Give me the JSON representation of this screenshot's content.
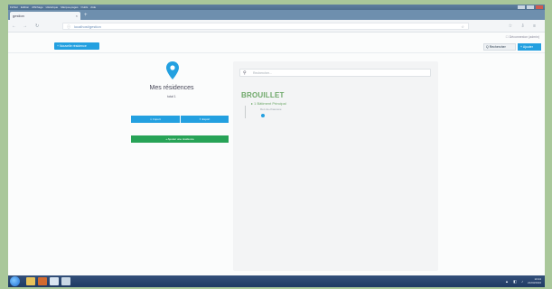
{
  "window": {
    "menu": [
      "Fichier",
      "Edition",
      "Affichage",
      "Historique",
      "Marque-pages",
      "Outils",
      "Aide"
    ],
    "tab_title": "gestion",
    "tab_close": "×",
    "new_tab": "+"
  },
  "addressbar": {
    "url": "localhost/gestion",
    "back": "←",
    "forward": "→",
    "reload": "↻",
    "lock": "ⓘ",
    "star": "☆",
    "right_icons": "☆ ⇩ ≡"
  },
  "apptoolbar": {
    "logout": "☐ Déconnexion (admin)",
    "add_button": "+ Nouvelle résidence",
    "search_button": "Q Rechercher",
    "right_button": "+ Ajouter"
  },
  "left": {
    "title": "Mes résidences",
    "subtitle": "total 1",
    "btn_left": "⇩ Import",
    "btn_right": "⇧ Export",
    "btn_green": "+ Ajouter une résidence"
  },
  "panel": {
    "search_placeholder": "Rechercher...",
    "search_icon": "🔍",
    "tree_title": "BROUILLET",
    "tree_node": "▸ 1 Bâtiment Principal",
    "tree_sub": "Rez-de-chaussée"
  },
  "taskbar": {
    "tray": "▲ ◧ ♪",
    "time": "10:24",
    "date": "21/03/2016"
  },
  "colors": {
    "accent_blue": "#23a0e0",
    "accent_green": "#27a357",
    "tree_green": "#6ea869"
  }
}
